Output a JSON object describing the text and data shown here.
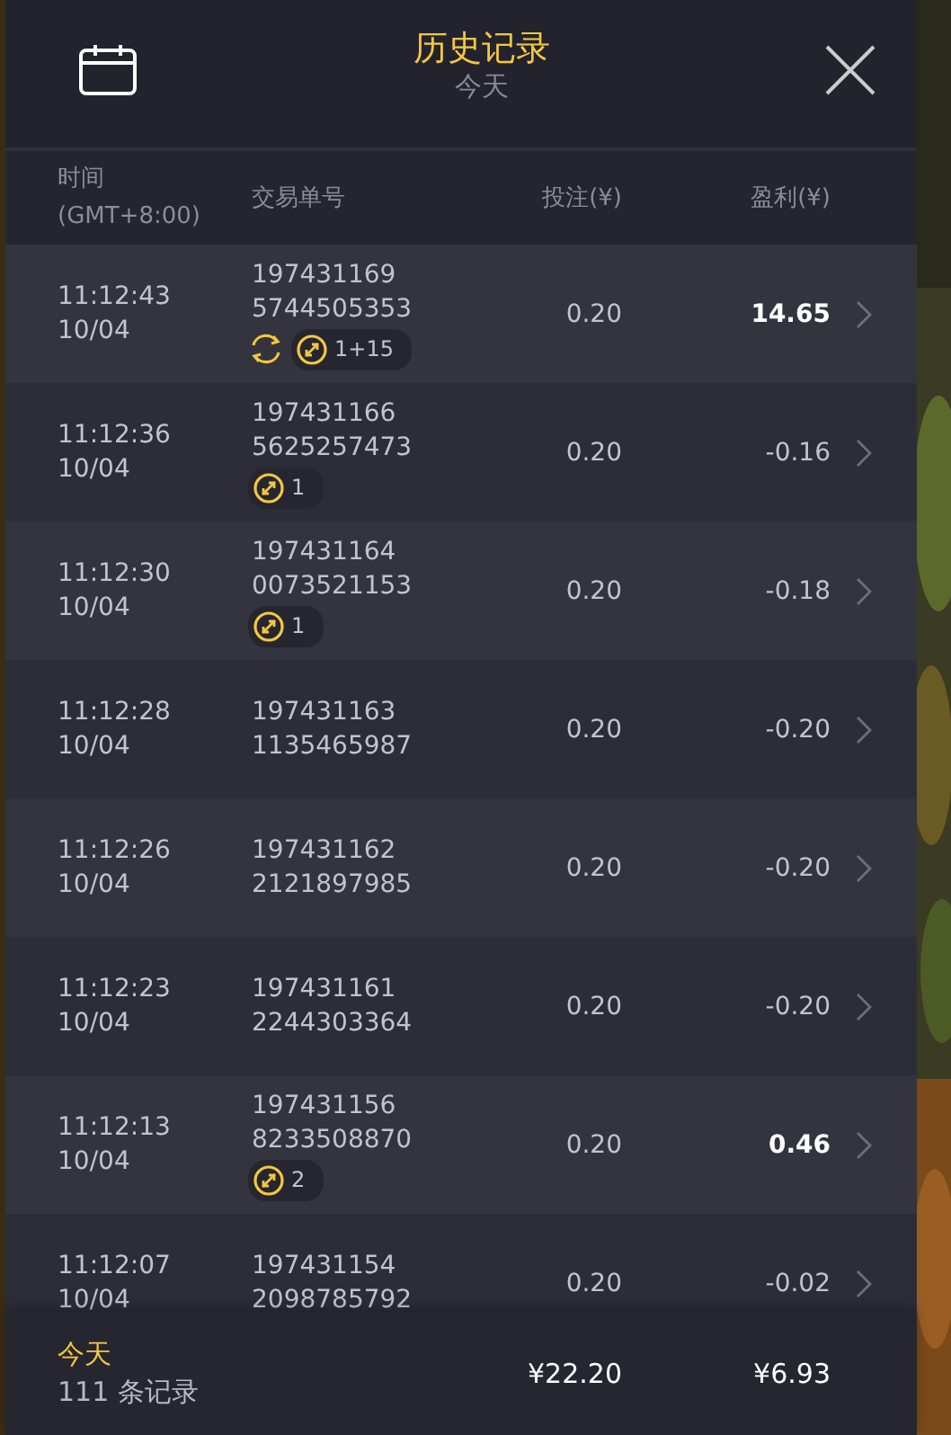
{
  "header": {
    "title": "历史记录",
    "subtitle": "今天"
  },
  "columns": {
    "time": "时间",
    "timezone": "(GMT+8:00)",
    "order": "交易单号",
    "bet": "投注(¥)",
    "profit": "盈利(¥)"
  },
  "records": [
    {
      "time": "11:12:43",
      "date": "10/04",
      "order_1": "197431169",
      "order_2": "5744505353",
      "bet": "0.20",
      "profit": "14.65",
      "win": true,
      "badges": [
        {
          "kind": "respin"
        },
        {
          "kind": "bonus",
          "count": "1+15"
        }
      ]
    },
    {
      "time": "11:12:36",
      "date": "10/04",
      "order_1": "197431166",
      "order_2": "5625257473",
      "bet": "0.20",
      "profit": "-0.16",
      "win": false,
      "badges": [
        {
          "kind": "bonus",
          "count": "1"
        }
      ]
    },
    {
      "time": "11:12:30",
      "date": "10/04",
      "order_1": "197431164",
      "order_2": "0073521153",
      "bet": "0.20",
      "profit": "-0.18",
      "win": false,
      "badges": [
        {
          "kind": "bonus",
          "count": "1"
        }
      ]
    },
    {
      "time": "11:12:28",
      "date": "10/04",
      "order_1": "197431163",
      "order_2": "1135465987",
      "bet": "0.20",
      "profit": "-0.20",
      "win": false
    },
    {
      "time": "11:12:26",
      "date": "10/04",
      "order_1": "197431162",
      "order_2": "2121897985",
      "bet": "0.20",
      "profit": "-0.20",
      "win": false
    },
    {
      "time": "11:12:23",
      "date": "10/04",
      "order_1": "197431161",
      "order_2": "2244303364",
      "bet": "0.20",
      "profit": "-0.20",
      "win": false
    },
    {
      "time": "11:12:13",
      "date": "10/04",
      "order_1": "197431156",
      "order_2": "8233508870",
      "bet": "0.20",
      "profit": "0.46",
      "win": true,
      "badges": [
        {
          "kind": "bonus",
          "count": "2"
        }
      ]
    },
    {
      "time": "11:12:07",
      "date": "10/04",
      "order_1": "197431154",
      "order_2": "2098785792",
      "bet": "0.20",
      "profit": "-0.02",
      "win": false
    }
  ],
  "footer": {
    "period": "今天",
    "count": "111 条记录",
    "total_bet": "¥22.20",
    "total_profit": "¥6.93"
  }
}
